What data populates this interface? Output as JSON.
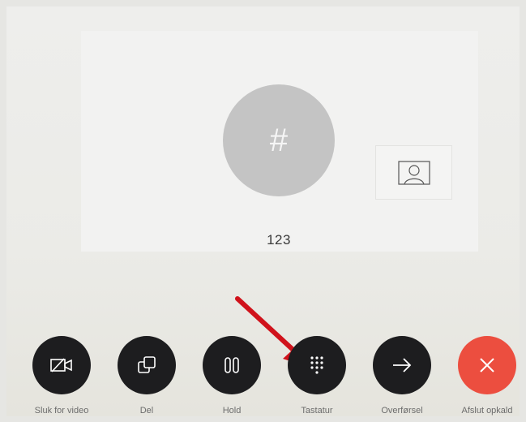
{
  "call": {
    "avatar_glyph": "#",
    "caller_number": "123"
  },
  "controls": [
    {
      "label": "Sluk for video",
      "icon": "video-off-icon"
    },
    {
      "label": "Del",
      "icon": "share-icon"
    },
    {
      "label": "Hold",
      "icon": "pause-icon"
    },
    {
      "label": "Tastatur",
      "icon": "keypad-icon"
    },
    {
      "label": "Overførsel",
      "icon": "arrow-right-icon"
    },
    {
      "label": "Afslut opkald",
      "icon": "close-icon"
    }
  ],
  "colors": {
    "button_dark": "#1d1d1f",
    "end_call": "#ec4e3f",
    "annotation_arrow": "#d0121b",
    "avatar": "#c4c4c4"
  }
}
